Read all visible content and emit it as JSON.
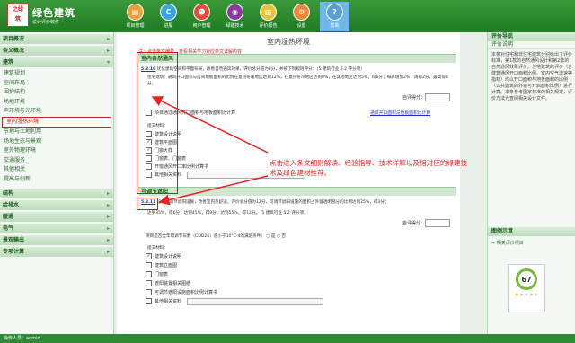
{
  "app": {
    "title": "绿色建筑",
    "subtitle": "设计评价软件",
    "logo_text": "之绿 筑"
  },
  "nav": [
    {
      "label": "项目管理",
      "icon": "folder-icon",
      "color": "#e8a23a"
    },
    {
      "label": "进展",
      "icon": "c-icon",
      "color": "#3aa5e0"
    },
    {
      "label": "用户管理",
      "icon": "user-icon",
      "color": "#e64a3a"
    },
    {
      "label": "绿建技术",
      "icon": "globe-icon",
      "color": "#8a3a9e"
    },
    {
      "label": "评价报告",
      "icon": "chart-icon",
      "color": "#e8c23a"
    },
    {
      "label": "设置",
      "icon": "gear-icon",
      "color": "#e88a3a"
    },
    {
      "label": "帮助",
      "icon": "help-icon",
      "color": "#ffffff"
    }
  ],
  "sidebar": {
    "groups_top": [
      "项目概况",
      "条文概况"
    ],
    "group_jianzhu": "建筑",
    "items": [
      "建筑规划",
      "空间布局",
      "围护结构",
      "场地环境",
      "声环境与光环境",
      "室内湿热环境",
      "节地与土地利用",
      "场地生态与景观",
      "室外物理环境",
      "交通服务",
      "其他相关",
      "提高与创新"
    ],
    "active_index": 5,
    "groups_bottom": [
      "结构",
      "给排水",
      "暖通",
      "电气",
      "景观输出",
      "专项计算"
    ]
  },
  "main": {
    "title": "室内湿热环境",
    "tip_prefix": "注：点击条文编号，查看相关学习对应条文详解内容",
    "section1": "室内自然通风",
    "s1_code": "5.2.10",
    "s1_text1": "优化建筑空间和平面布局，改善自然通风效果，评价总分值为8分，并按下列规则评分：（5 建筑行业 5.2 评分项）",
    "s1_text2": "住宅建筑：通风开口面积与房间地板面积的比例在夏热冬暖地区达到12%，在夏热冬冷地区达到8%，在其他地区达到5%，得6分；每再增加2%，再得2分，最高得8分。",
    "score_label": "自评得分：",
    "s1_check": "项目通过通风开口面积与地板面积比计算",
    "s1_link": "通风开口面积与地板面积比计算",
    "files_label": "提交材料：",
    "s1_files": [
      "建筑设计说明",
      "建筑平面图",
      "门窗大样",
      "门窗表、门窗表",
      "开窗通风开口率比例计算书",
      "其他相关资料"
    ],
    "s1_checked": [
      false,
      true,
      true,
      false,
      false,
      false
    ],
    "section2": "可调节遮阳",
    "s2_code": "5.2.11",
    "s2_text1": "设置可调节遮阳设施，改善室内热舒适，评价总分值为12分，可调节遮阳设施的面积占外窗透明部分的比例达到25%，得3分；",
    "s2_text2": "达到35%，得6分；达到45%，得9分；达到55%，得12分。（5 建筑行业 5.2 评分项）",
    "s2_radio_label": "项目是否全年需调节日数（CDD26）值小于10°C·d的满足条件：",
    "radio_yes": "是",
    "radio_no": "否",
    "s2_files": [
      "建筑设计说明",
      "建筑立面图",
      "门窗表",
      "遮阳装置相关图纸",
      "可调节遮阳设施面积比例计算书",
      "其他相关资料"
    ],
    "s2_checked": [
      true,
      false,
      false,
      false,
      false,
      false
    ]
  },
  "annotation": "点击进入条文细则解读、经验指导、技术详解以及相对应的绿建技术及绿色建材推荐。",
  "right": {
    "head1": "评价导航",
    "sub1": "评价说明",
    "text": "本条对住宅和非住宅建筑分别给出了评价标准，第1款的自然通风设计和第2款的自然通风效果评价。住宅建筑的评价（含建筑通风开口面积比例、室内空气流速等指标）均以开口面积与地板面积的比例（公共建筑的外窗可开启面积比例）进行计算。本条参考国家标准的相关规定，评价方法为查阅相关设计文件。",
    "head2": "图例示意",
    "legend_item": "相关评价项目",
    "score": "67",
    "stars_filled": 1,
    "stars_total": 5
  },
  "status": "操作人员：admin"
}
